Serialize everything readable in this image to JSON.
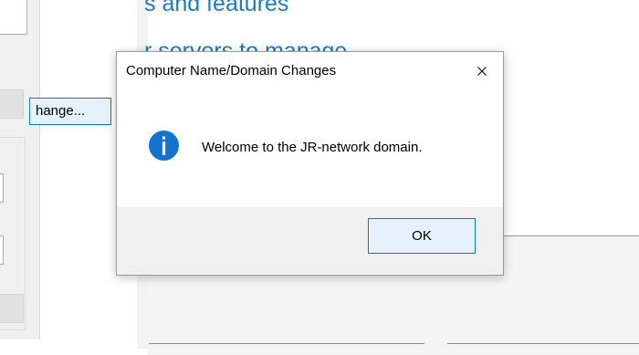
{
  "background": {
    "server_manager": {
      "heading_roles": "s and features",
      "heading_servers": "r servers to manage"
    },
    "system_properties": {
      "change_button_label": "hange..."
    }
  },
  "dialog": {
    "title": "Computer Name/Domain Changes",
    "close_glyph": "×",
    "icon": "information-icon",
    "message": "Welcome to the JR-network domain.",
    "ok_label": "OK"
  },
  "colors": {
    "accent_blue": "#0078d7",
    "info_icon_blue": "#1373d1",
    "heading_blue": "#1e7bc0",
    "button_face": "#e5f1fb",
    "footer_gray": "#f0f0f0"
  }
}
